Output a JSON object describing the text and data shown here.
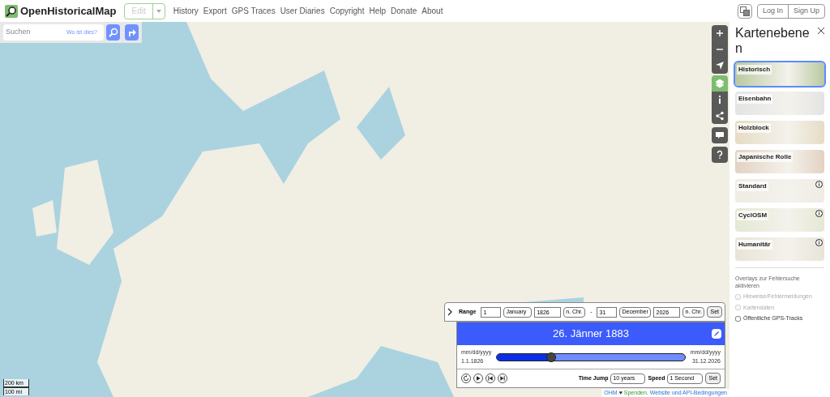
{
  "header": {
    "logo": "OpenHistoricalMap",
    "edit": "Edit",
    "nav": [
      "History",
      "Export",
      "GPS Traces",
      "User Diaries",
      "Copyright",
      "Help",
      "Donate",
      "About"
    ],
    "login": "Log In",
    "signup": "Sign Up"
  },
  "search": {
    "placeholder": "Suchen",
    "where": "Wo ist dies?"
  },
  "map_controls": [
    {
      "kind": "zoom-in",
      "selected": false
    },
    {
      "kind": "zoom-out",
      "selected": false
    },
    {
      "kind": "locate",
      "selected": false
    },
    {
      "kind": "layers",
      "selected": true
    },
    {
      "kind": "info",
      "selected": false
    },
    {
      "kind": "share",
      "selected": false
    },
    {
      "kind": "note",
      "selected": false
    },
    {
      "kind": "help",
      "selected": false
    }
  ],
  "layers_panel": {
    "title": "Kartenebenen",
    "layers": [
      {
        "label": "Historisch",
        "selected": true,
        "info": false,
        "color": "#b9c9a0"
      },
      {
        "label": "Eisenbahn",
        "selected": false,
        "info": false,
        "color": "#e4e4e4"
      },
      {
        "label": "Holzblock",
        "selected": false,
        "info": false,
        "color": "#e6dcc6"
      },
      {
        "label": "Japanische Rolle",
        "selected": false,
        "info": false,
        "color": "#e2d2c2"
      },
      {
        "label": "Standard",
        "selected": false,
        "info": true,
        "color": "#efece4"
      },
      {
        "label": "CyclOSM",
        "selected": false,
        "info": true,
        "color": "#e4e8d4"
      },
      {
        "label": "Humanitär",
        "selected": false,
        "info": true,
        "color": "#e8e4d8"
      }
    ],
    "overlay_title": "Overlays zur Fehlersuche aktivieren",
    "overlays": [
      {
        "label": "Hinweise/Fehlermeldungen",
        "checked": false,
        "disabled": true
      },
      {
        "label": "Kartendaten",
        "checked": false,
        "disabled": true
      },
      {
        "label": "Öffentliche GPS-Tracks",
        "checked": false,
        "disabled": false
      }
    ]
  },
  "time_slider": {
    "range_label": "Range",
    "start_day": "1",
    "start_month": "January",
    "start_year": "1826",
    "start_era": "n. Chr.",
    "dash": "-",
    "end_day": "31",
    "end_month": "December",
    "end_year": "2026",
    "end_era": "n. Chr.",
    "range_set": "Set",
    "current_date": "26. Jänner 1883",
    "start_format": "mm/dd/yyyy",
    "start_date": "1.1.1826",
    "end_format": "mm/dd/yyyy",
    "end_date": "31.12.2026",
    "level": 0.29,
    "time_jump_label": "Time Jump",
    "time_jump": "10 years",
    "speed_label": "Speed",
    "speed": "1 Second",
    "set": "Set"
  },
  "scale": [
    "200 km",
    "100 mi"
  ],
  "attribution": {
    "ohm": "OHM",
    "heart": "♥",
    "donate": "Spenden.",
    "terms": "Website und API-Bedingungen"
  }
}
